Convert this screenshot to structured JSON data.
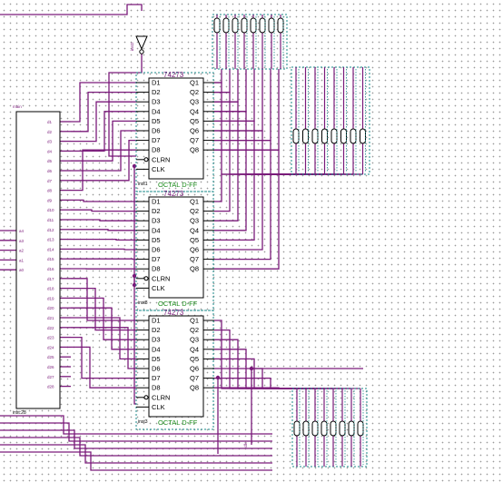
{
  "schematic": {
    "inverter_instance": "inst2",
    "left_block": {
      "top_label": "main",
      "instance": "inst:28",
      "pins": [
        "d1",
        "d2",
        "d3",
        "d4",
        "d5",
        "d6",
        "d7",
        "d8",
        "d9",
        "d10",
        "d11",
        "d12",
        "d13",
        "d14",
        "d15",
        "d16",
        "d17",
        "d18",
        "d19",
        "d20",
        "d21",
        "d22",
        "d23",
        "d24",
        "d25",
        "d26",
        "d27",
        "d28"
      ],
      "side_pins": [
        "a4",
        "a3",
        "a2",
        "a1",
        "a0"
      ]
    },
    "chips": [
      {
        "part": "74273",
        "instance": "inst1",
        "type": "OCTAL D-FF"
      },
      {
        "part": "74273",
        "instance": "inst8",
        "type": "OCTAL D-FF"
      },
      {
        "part": "74273",
        "instance": "inst3",
        "type": "OCTAL D-FF"
      }
    ],
    "chip_inputs": [
      "D1",
      "D2",
      "D3",
      "D4",
      "D5",
      "D6",
      "D7",
      "D8",
      "CLRN",
      "CLK"
    ],
    "chip_outputs": [
      "Q1",
      "Q2",
      "Q3",
      "Q4",
      "Q5",
      "Q6",
      "Q7",
      "Q8"
    ],
    "bottom_net": "clk"
  },
  "colors": {
    "wire": "#7a1a7a",
    "chip_border": "#000000",
    "group_border": "#1a8a8a",
    "subtitle": "#1a8a1a"
  }
}
